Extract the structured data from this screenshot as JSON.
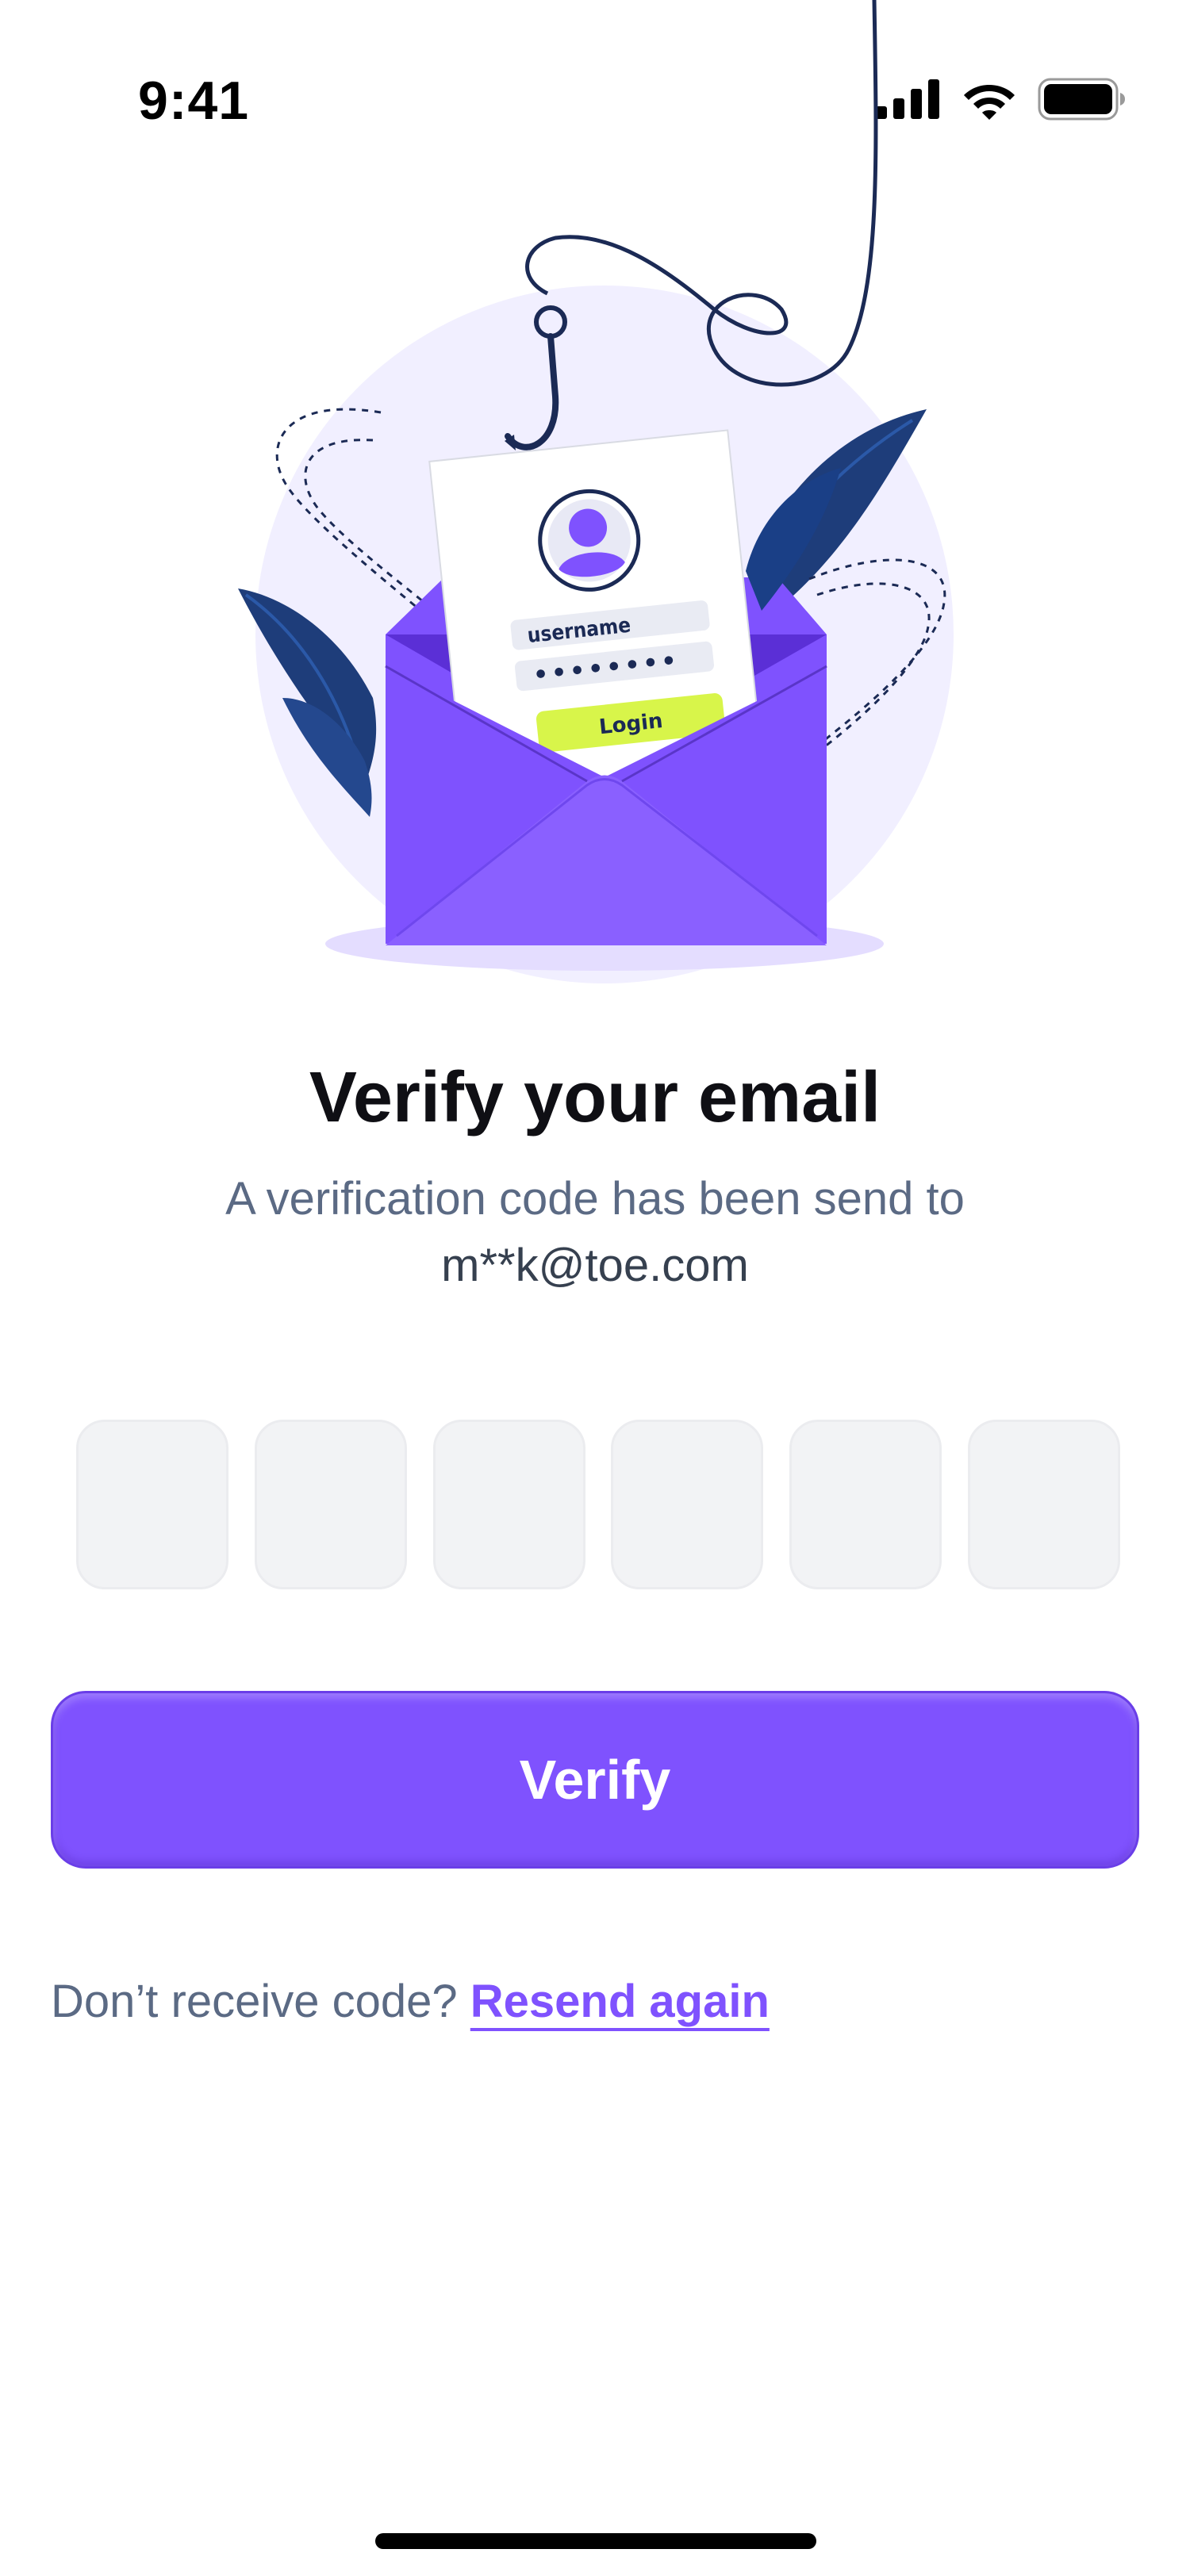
{
  "status_bar": {
    "time": "9:41",
    "icons": [
      "cellular-signal-icon",
      "wifi-icon",
      "battery-icon"
    ]
  },
  "illustration": {
    "username_label": "username",
    "password_mask": "••••••••",
    "login_label": "Login",
    "icons": [
      "fishing-hook-icon",
      "envelope-icon",
      "avatar-icon",
      "leaf-icon"
    ]
  },
  "title": "Verify your email",
  "subtitle": {
    "line1": "A verification code has been send to",
    "email": "m**k@toe.com"
  },
  "code_inputs": [
    {
      "value": ""
    },
    {
      "value": ""
    },
    {
      "value": ""
    },
    {
      "value": ""
    },
    {
      "value": ""
    },
    {
      "value": ""
    }
  ],
  "verify_button": {
    "label": "Verify"
  },
  "resend": {
    "prompt": "Don’t receive code?",
    "link": "Resend again"
  },
  "colors": {
    "accent": "#7F52FE",
    "input_bg": "#F2F3F5",
    "text_muted": "#5B6A84",
    "lime": "#D8F54A",
    "navy": "#1B2A55"
  }
}
